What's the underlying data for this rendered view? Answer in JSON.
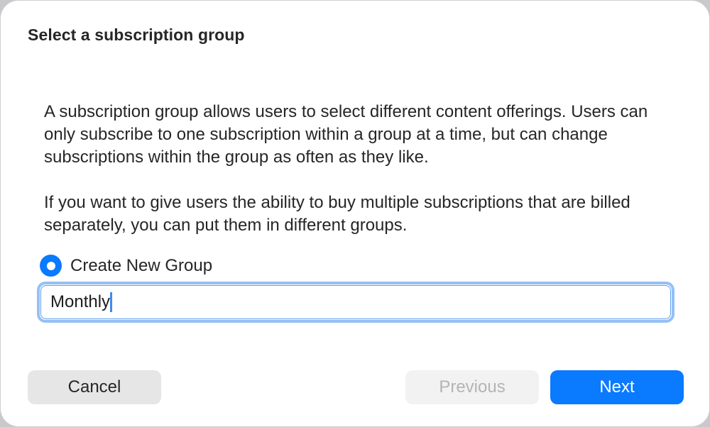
{
  "dialog": {
    "title": "Select a subscription group",
    "description": [
      "A subscription group allows users to select different content offerings. Users can only subscribe to one subscription within a group at a time, but can change subscriptions within the group as often as they like.",
      "If you want to give users the ability to buy multiple subscriptions that are billed separately, you can put them in different groups."
    ],
    "option": {
      "label": "Create New Group",
      "selected": true
    },
    "group_name_field": {
      "value": "Monthly",
      "focused": true
    },
    "buttons": {
      "cancel": "Cancel",
      "previous": "Previous",
      "next": "Next"
    },
    "colors": {
      "accent": "#0a7aff",
      "focus_ring": "#94c0f5",
      "disabled_text": "#b4b4b6"
    }
  }
}
